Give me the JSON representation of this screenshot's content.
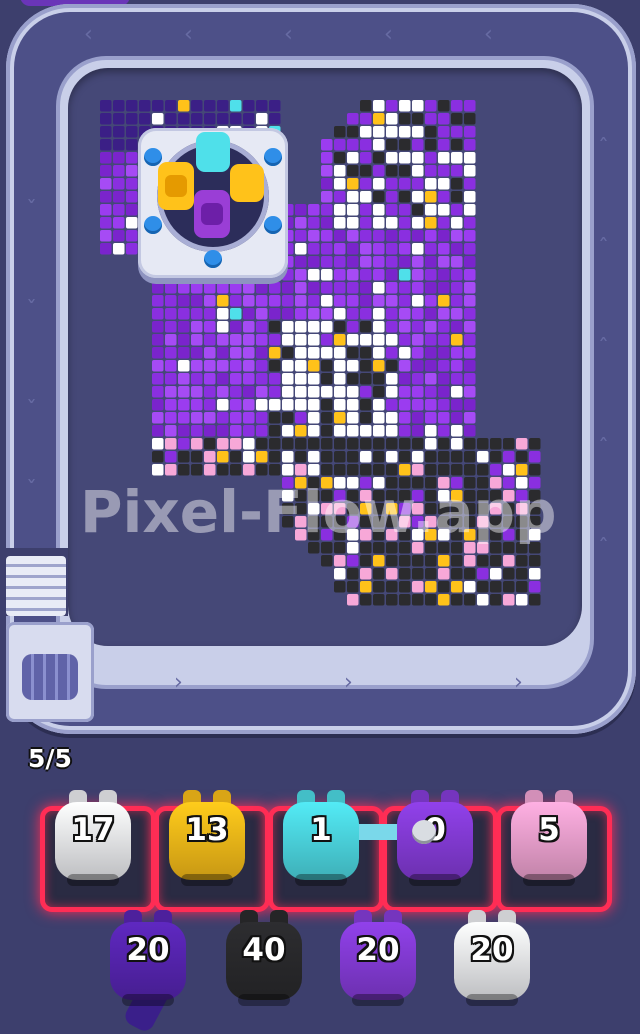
{
  "watermark": "Pixel-Flow.app",
  "moves_counter": "5/5",
  "colors": {
    "white": "#f2f3f7",
    "yellow": "#ffc21a",
    "cyan": "#4fe0ea",
    "purple": "#8a3ee0",
    "pink": "#f7a8d8",
    "dark_purple": "#5a26b8",
    "black": "#2b2b2e",
    "highlight_red": "#ff2d55"
  },
  "feeder": {
    "blocks": [
      {
        "color": "cyan",
        "icon": "cyan-block-icon"
      },
      {
        "color": "yellow",
        "icon": "yellow-critter-icon"
      },
      {
        "color": "yellow",
        "icon": "yellow-block-icon"
      },
      {
        "color": "purple",
        "icon": "purple-critter-icon"
      }
    ]
  },
  "slots": [
    {
      "color": "white",
      "count": "17"
    },
    {
      "color": "yellow",
      "count": "13"
    },
    {
      "color": "cyan",
      "count": "1"
    },
    {
      "color": "purple",
      "count": "0"
    },
    {
      "color": "pink",
      "count": "5"
    }
  ],
  "queue": [
    {
      "color": "dark_purple",
      "count": "20"
    },
    {
      "color": "black",
      "count": "40"
    },
    {
      "color": "purple",
      "count": "20"
    },
    {
      "color": "white",
      "count": "20"
    }
  ]
}
